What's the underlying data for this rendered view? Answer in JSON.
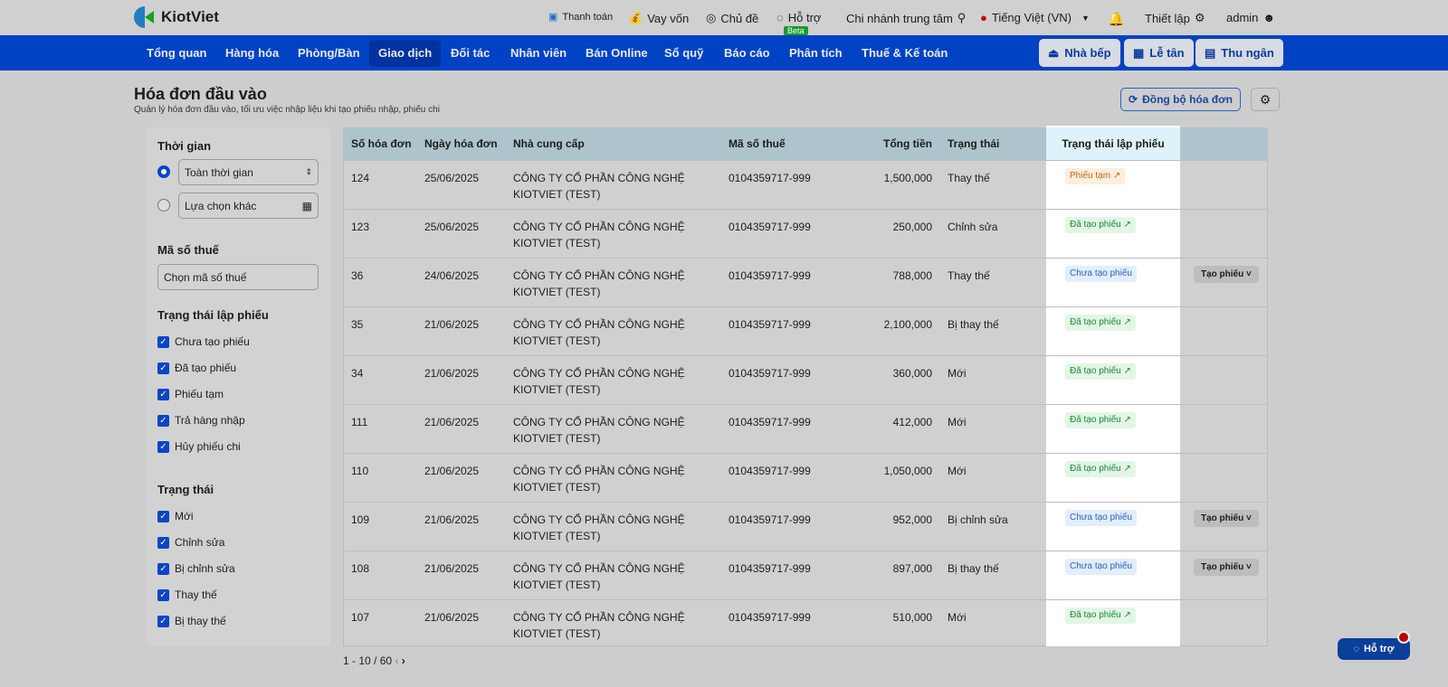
{
  "top": {
    "brand": "KiotViet",
    "links": [
      "Thanh toán",
      "Vay vốn",
      "Chủ đề",
      "Hỗ trợ",
      "Chi nhánh trung tâm",
      "Tiếng Việt (VN)",
      "Thiết lập",
      "admin"
    ],
    "beta": "Beta"
  },
  "nav": {
    "items": [
      "Tổng quan",
      "Hàng hóa",
      "Phòng/Bàn",
      "Giao dịch",
      "Đối tác",
      "Nhân viên",
      "Bán Online",
      "Sổ quỹ",
      "Báo cáo",
      "Phân tích",
      "Thuế & Kế toán"
    ],
    "active": "Giao dịch",
    "buttons": [
      "Nhà bếp",
      "Lễ tân",
      "Thu ngân"
    ]
  },
  "page": {
    "title": "Hóa đơn đầu vào",
    "subtitle": "Quản lý hóa đơn đầu vào, tối ưu việc nhập liệu khi tạo phiếu nhập, phiếu chi",
    "sync": "Đồng bộ hóa đơn"
  },
  "filters": {
    "time_title": "Thời gian",
    "time_all": "Toàn thời gian",
    "time_custom": "Lựa chọn khác",
    "tax_title": "Mã số thuế",
    "tax_placeholder": "Chọn mã số thuế",
    "ticket_title": "Trạng thái lập phiếu",
    "ticket_options": [
      "Chưa tạo phiếu",
      "Đã tạo phiếu",
      "Phiếu tạm",
      "Trả hàng nhập",
      "Hủy phiếu chi"
    ],
    "status_title": "Trạng thái",
    "status_options": [
      "Mới",
      "Chỉnh sửa",
      "Bị chỉnh sửa",
      "Thay thế",
      "Bị thay thế"
    ]
  },
  "table": {
    "headers": [
      "Số hóa đơn",
      "Ngày hóa đơn",
      "Nhà cung cấp",
      "Mã số thuế",
      "Tổng tiền",
      "Trạng thái",
      "Trạng thái lập phiếu"
    ],
    "create_label": "Tạo phiếu",
    "rows": [
      [
        "124",
        "25/06/2025",
        "CÔNG TY CỔ PHẦN CÔNG NGHỆ KIOTVIET (TEST)",
        "0104359717-999",
        "1,500,000",
        "Thay thế",
        "Phiếu tạm"
      ],
      [
        "123",
        "25/06/2025",
        "CÔNG TY CỔ PHẦN CÔNG NGHỆ KIOTVIET (TEST)",
        "0104359717-999",
        "250,000",
        "Chỉnh sửa",
        "Đã tạo phiếu"
      ],
      [
        "36",
        "24/06/2025",
        "CÔNG TY CỔ PHẦN CÔNG NGHỆ KIOTVIET (TEST)",
        "0104359717-999",
        "788,000",
        "Thay thế",
        "Chưa tạo phiếu"
      ],
      [
        "35",
        "21/06/2025",
        "CÔNG TY CỔ PHẦN CÔNG NGHỆ KIOTVIET (TEST)",
        "0104359717-999",
        "2,100,000",
        "Bị thay thế",
        "Đã tạo phiếu"
      ],
      [
        "34",
        "21/06/2025",
        "CÔNG TY CỔ PHẦN CÔNG NGHỆ KIOTVIET (TEST)",
        "0104359717-999",
        "360,000",
        "Mới",
        "Đã tạo phiếu"
      ],
      [
        "111",
        "21/06/2025",
        "CÔNG TY CỔ PHẦN CÔNG NGHỆ KIOTVIET (TEST)",
        "0104359717-999",
        "412,000",
        "Mới",
        "Đã tạo phiếu"
      ],
      [
        "110",
        "21/06/2025",
        "CÔNG TY CỔ PHẦN CÔNG NGHỆ KIOTVIET (TEST)",
        "0104359717-999",
        "1,050,000",
        "Mới",
        "Đã tạo phiếu"
      ],
      [
        "109",
        "21/06/2025",
        "CÔNG TY CỔ PHẦN CÔNG NGHỆ KIOTVIET (TEST)",
        "0104359717-999",
        "952,000",
        "Bị chỉnh sửa",
        "Chưa tạo phiếu"
      ],
      [
        "108",
        "21/06/2025",
        "CÔNG TY CỔ PHẦN CÔNG NGHỆ KIOTVIET (TEST)",
        "0104359717-999",
        "897,000",
        "Bị thay thế",
        "Chưa tạo phiếu"
      ],
      [
        "107",
        "21/06/2025",
        "CÔNG TY CỔ PHẦN CÔNG NGHỆ KIOTVIET (TEST)",
        "0104359717-999",
        "510,000",
        "Mới",
        "Đã tạo phiếu"
      ]
    ]
  },
  "pagination": "1 - 10 / 60",
  "help": "Hỗ trợ",
  "colors": {
    "nav": "#0042c4",
    "draft": "#e0801a",
    "done": "#1a9a3c",
    "pending": "#2a62c9"
  }
}
